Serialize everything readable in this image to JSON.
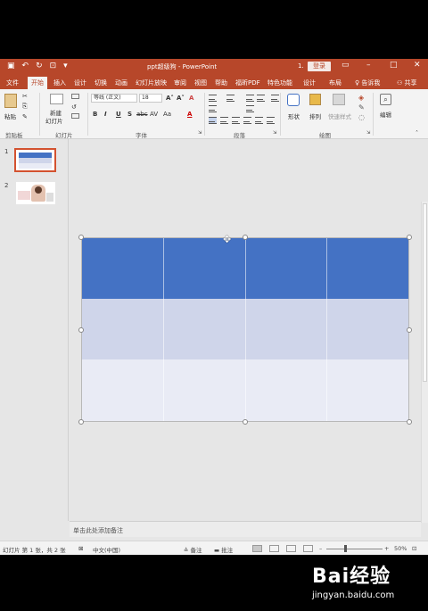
{
  "titlebar": {
    "title": "ppt超级狗 - PowerPoint",
    "user_initial": "1.",
    "login_label": "登录"
  },
  "tabs": [
    {
      "label": "文件"
    },
    {
      "label": "开始",
      "active": true
    },
    {
      "label": "插入"
    },
    {
      "label": "设计"
    },
    {
      "label": "切换"
    },
    {
      "label": "动画"
    },
    {
      "label": "幻灯片放映"
    },
    {
      "label": "审阅"
    },
    {
      "label": "视图"
    },
    {
      "label": "帮助"
    },
    {
      "label": "福昕PDF"
    },
    {
      "label": "特色功能"
    },
    {
      "label": "设计"
    },
    {
      "label": "布局"
    },
    {
      "label": "告诉我"
    },
    {
      "label": "共享"
    }
  ],
  "ribbon": {
    "paste_label": "粘贴",
    "new_slide_label_1": "新建",
    "new_slide_label_2": "幻灯片",
    "font_name": "等线 (正文)",
    "font_size": "18",
    "shape_label": "形状",
    "arrange_label": "排列",
    "quick_style_label": "快速样式",
    "edit_label": "编辑",
    "groups": {
      "clipboard": "剪贴板",
      "slides": "幻灯片",
      "font": "字体",
      "paragraph": "段落",
      "drawing": "绘图"
    }
  },
  "thumbnails": [
    {
      "number": "1"
    },
    {
      "number": "2"
    }
  ],
  "notes_placeholder": "单击此处添加备注",
  "status": {
    "slide_info": "幻灯片 第 1 张，共 2 张",
    "language": "中文(中国)",
    "notes_btn": "备注",
    "comments_btn": "批注",
    "zoom": "50%"
  },
  "watermark": {
    "brand": "Bai经验",
    "url": "jingyan.baidu.com"
  },
  "colors": {
    "accent": "#b7472a",
    "table_header": "#4472c4",
    "table_row_1": "#cfd5ea",
    "table_row_2": "#e9ebf5"
  }
}
